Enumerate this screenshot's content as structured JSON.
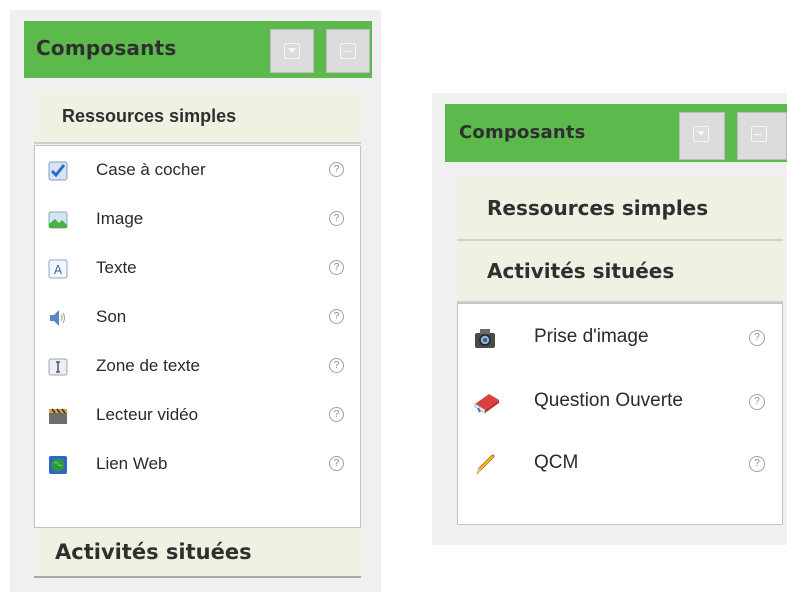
{
  "panel_left": {
    "header": {
      "title": "Composants"
    },
    "section_resources": {
      "label": "Ressources simples"
    },
    "items": [
      {
        "label": "Case à cocher",
        "icon": "checkbox-icon"
      },
      {
        "label": "Image",
        "icon": "image-icon"
      },
      {
        "label": "Texte",
        "icon": "text-icon"
      },
      {
        "label": "Son",
        "icon": "sound-icon"
      },
      {
        "label": "Zone de texte",
        "icon": "textarea-icon"
      },
      {
        "label": "Lecteur vidéo",
        "icon": "video-icon"
      },
      {
        "label": "Lien Web",
        "icon": "web-link-icon"
      }
    ],
    "section_activities": {
      "label": "Activités situées"
    },
    "help_glyph": "?"
  },
  "panel_right": {
    "header": {
      "title": "Composants"
    },
    "section_resources": {
      "label": "Ressources simples"
    },
    "section_activities": {
      "label": "Activités situées"
    },
    "items": [
      {
        "label": "Prise d'image",
        "icon": "camera-icon"
      },
      {
        "label": "Question Ouverte",
        "icon": "book-icon"
      },
      {
        "label": "QCM",
        "icon": "pencil-icon"
      }
    ],
    "help_glyph": "?"
  },
  "colors": {
    "header_green": "#5cb94c",
    "section_bg": "#eef2e2"
  }
}
